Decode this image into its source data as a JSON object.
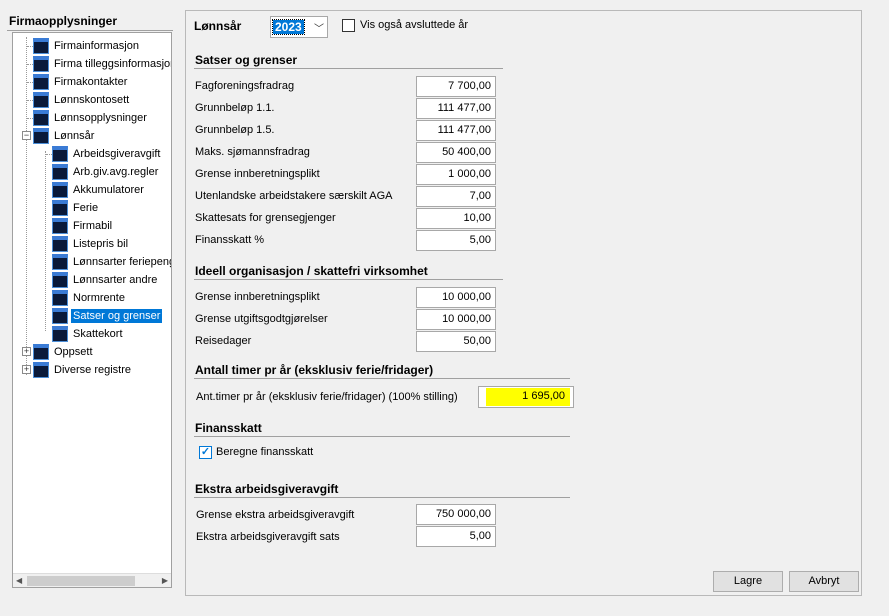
{
  "left": {
    "title": "Firmaopplysninger",
    "tree": [
      {
        "label": "Firmainformasjon",
        "level": 0
      },
      {
        "label": "Firma tilleggsinformasjon",
        "level": 0
      },
      {
        "label": "Firmakontakter",
        "level": 0
      },
      {
        "label": "Lønnskontosett",
        "level": 0
      },
      {
        "label": "Lønnsopplysninger",
        "level": 0
      },
      {
        "label": "Lønnsår",
        "level": 0,
        "expander": "−"
      },
      {
        "label": "Arbeidsgiveravgift",
        "level": 1
      },
      {
        "label": "Arb.giv.avg.regler",
        "level": 1
      },
      {
        "label": "Akkumulatorer",
        "level": 1
      },
      {
        "label": "Ferie",
        "level": 1
      },
      {
        "label": "Firmabil",
        "level": 1
      },
      {
        "label": "Listepris bil",
        "level": 1
      },
      {
        "label": "Lønnsarter feriepenger",
        "level": 1
      },
      {
        "label": "Lønnsarter andre",
        "level": 1
      },
      {
        "label": "Normrente",
        "level": 1
      },
      {
        "label": "Satser og grenser",
        "level": 1,
        "selected": true
      },
      {
        "label": "Skattekort",
        "level": 1
      },
      {
        "label": "Oppsett",
        "level": 0,
        "expander": "+"
      },
      {
        "label": "Diverse registre",
        "level": 0,
        "expander": "+"
      }
    ]
  },
  "header": {
    "year_label": "Lønnsår",
    "year_value": "2023",
    "show_closed_label": "Vis også avsluttede år"
  },
  "sections": {
    "satser": {
      "title": "Satser og grenser",
      "rows": [
        {
          "label": "Fagforeningsfradrag",
          "value": "7 700,00"
        },
        {
          "label": "Grunnbeløp 1.1.",
          "value": "111 477,00"
        },
        {
          "label": "Grunnbeløp 1.5.",
          "value": "111 477,00"
        },
        {
          "label": "Maks. sjømannsfradrag",
          "value": "50 400,00"
        },
        {
          "label": "Grense innberetningsplikt",
          "value": "1 000,00"
        },
        {
          "label": "Utenlandske arbeidstakere særskilt AGA",
          "value": "7,00"
        },
        {
          "label": "Skattesats for grensegjenger",
          "value": "10,00"
        },
        {
          "label": "Finansskatt %",
          "value": "5,00"
        }
      ]
    },
    "ideell": {
      "title": "Ideell organisasjon / skattefri virksomhet",
      "rows": [
        {
          "label": "Grense innberetningsplikt",
          "value": "10 000,00"
        },
        {
          "label": "Grense utgiftsgodtgjørelser",
          "value": "10 000,00"
        },
        {
          "label": "Reisedager",
          "value": "50,00"
        }
      ]
    },
    "timer": {
      "title": "Antall timer pr år (eksklusiv ferie/fridager)",
      "row_label": "Ant.timer pr år (eksklusiv ferie/fridager) (100% stilling)",
      "row_value": "1 695,00"
    },
    "finansskatt": {
      "title": "Finansskatt",
      "checkbox_label": "Beregne finansskatt"
    },
    "ekstra": {
      "title": "Ekstra arbeidsgiveravgift",
      "rows": [
        {
          "label": "Grense ekstra arbeidsgiveravgift",
          "value": "750 000,00"
        },
        {
          "label": "Ekstra arbeidsgiveravgift sats",
          "value": "5,00"
        }
      ]
    }
  },
  "buttons": {
    "save": "Lagre",
    "cancel": "Avbryt"
  }
}
